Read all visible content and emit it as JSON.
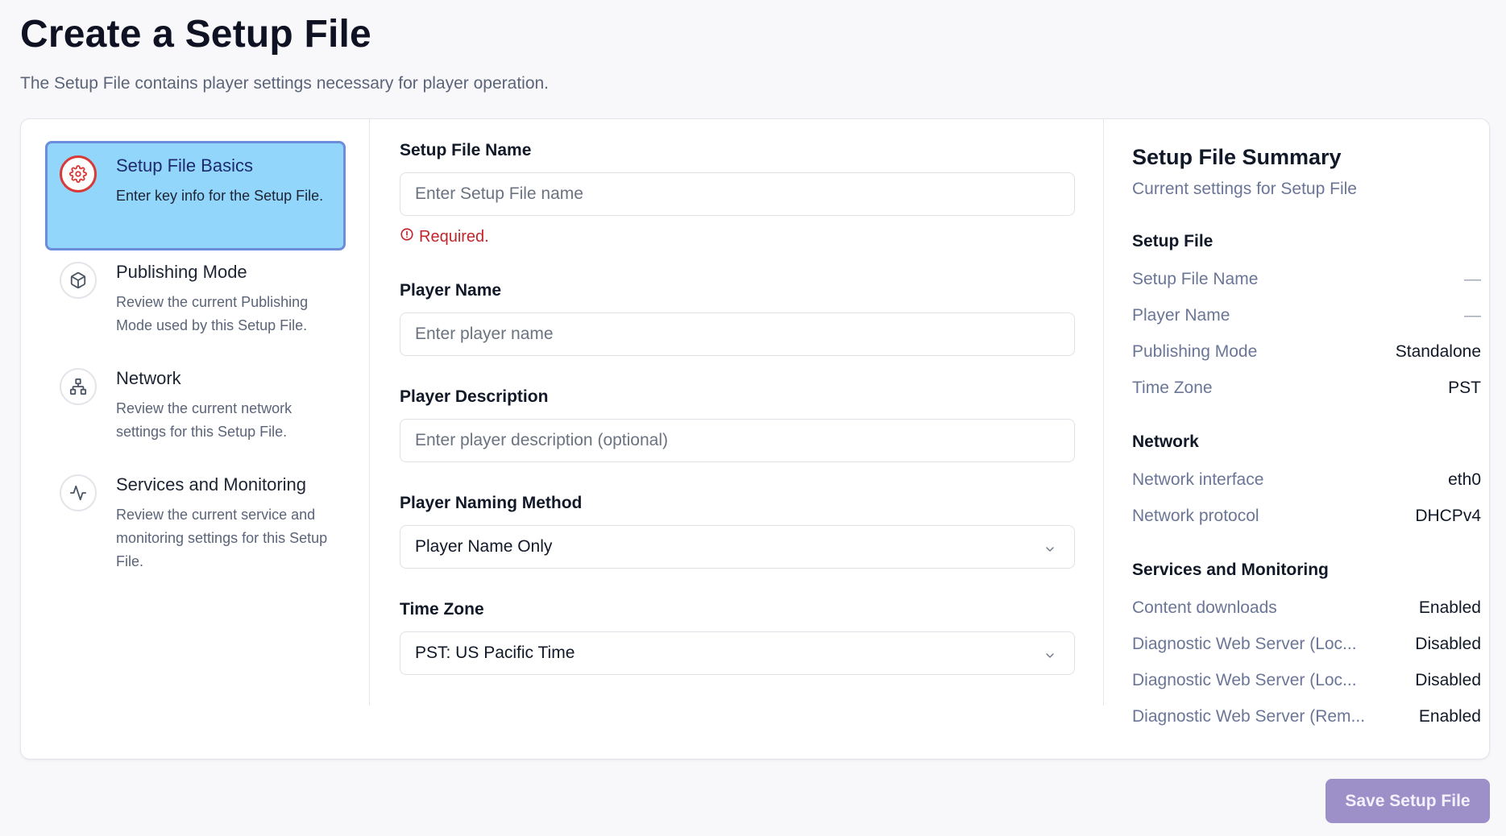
{
  "page": {
    "title": "Create a Setup File",
    "subtitle": "The Setup File contains player settings necessary for player operation."
  },
  "steps": [
    {
      "title": "Setup File Basics",
      "desc": "Enter key info for the Setup File.",
      "icon": "gear-icon",
      "active": true
    },
    {
      "title": "Publishing Mode",
      "desc": "Review the current Publishing Mode used by this Setup File.",
      "icon": "cube-icon",
      "active": false
    },
    {
      "title": "Network",
      "desc": "Review the current network settings for this Setup File.",
      "icon": "network-icon",
      "active": false
    },
    {
      "title": "Services and Monitoring",
      "desc": "Review the current service and monitoring settings for this Setup File.",
      "icon": "activity-icon",
      "active": false
    }
  ],
  "form": {
    "setup_file_name": {
      "label": "Setup File Name",
      "placeholder": "Enter Setup File name",
      "value": "",
      "error": "Required."
    },
    "player_name": {
      "label": "Player Name",
      "placeholder": "Enter player name",
      "value": ""
    },
    "player_description": {
      "label": "Player Description",
      "placeholder": "Enter player description (optional)",
      "value": ""
    },
    "player_naming_method": {
      "label": "Player Naming Method",
      "selected": "Player Name Only"
    },
    "time_zone": {
      "label": "Time Zone",
      "selected": "PST: US Pacific Time"
    }
  },
  "summary": {
    "title": "Setup File Summary",
    "subtitle": "Current settings for Setup File",
    "sections": [
      {
        "heading": "Setup File",
        "rows": [
          {
            "key": "Setup File Name",
            "value": "—"
          },
          {
            "key": "Player Name",
            "value": "—"
          },
          {
            "key": "Publishing Mode",
            "value": "Standalone"
          },
          {
            "key": "Time Zone",
            "value": "PST"
          }
        ]
      },
      {
        "heading": "Network",
        "rows": [
          {
            "key": "Network interface",
            "value": "eth0"
          },
          {
            "key": "Network protocol",
            "value": "DHCPv4"
          }
        ]
      },
      {
        "heading": "Services and Monitoring",
        "rows": [
          {
            "key": "Content downloads",
            "value": "Enabled"
          },
          {
            "key": "Diagnostic Web Server (Loc...",
            "value": "Disabled"
          },
          {
            "key": "Diagnostic Web Server (Loc...",
            "value": "Disabled"
          },
          {
            "key": "Diagnostic Web Server (Rem...",
            "value": "Enabled"
          }
        ]
      }
    ]
  },
  "actions": {
    "save_label": "Save Setup File"
  },
  "colors": {
    "accent": "#9d8fc7",
    "active_step_bg": "#93d6fb",
    "active_step_border": "#6b8ddb",
    "error": "#c0262d"
  }
}
